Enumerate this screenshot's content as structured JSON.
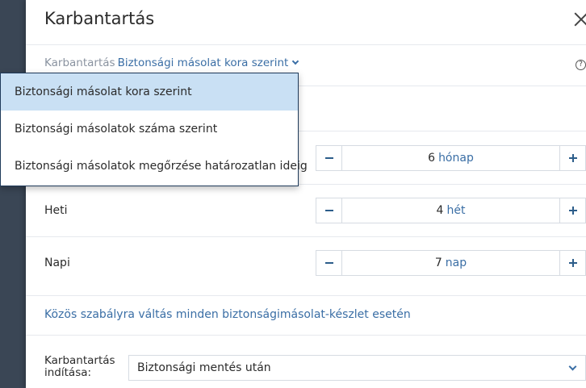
{
  "dialog": {
    "title": "Karbantartás"
  },
  "breadcrumb": {
    "label": "Karbantartás",
    "value": "Biztonsági másolat kora szerint"
  },
  "help": {
    "glyph": "?"
  },
  "dropdown": {
    "options": [
      "Biztonsági másolat kora szerint",
      "Biztonsági másolatok száma szerint",
      "Biztonsági másolatok megőrzése határozatlan ideig"
    ],
    "selected_index": 0
  },
  "retention": {
    "monthly": {
      "value": "6",
      "unit": "hónap"
    },
    "weekly": {
      "label": "Heti",
      "value": "4",
      "unit": "hét"
    },
    "daily": {
      "label": "Napi",
      "value": "7",
      "unit": "nap"
    }
  },
  "common_rule_link": "Közös szabályra váltás minden biztonságimásolat-készlet esetén",
  "start": {
    "label": "Karbantartás indítása:",
    "value": "Biztonsági mentés után"
  },
  "colors": {
    "accent": "#3a6ea5",
    "selected_bg": "#c9e0f4",
    "rail": "#3a4655"
  }
}
